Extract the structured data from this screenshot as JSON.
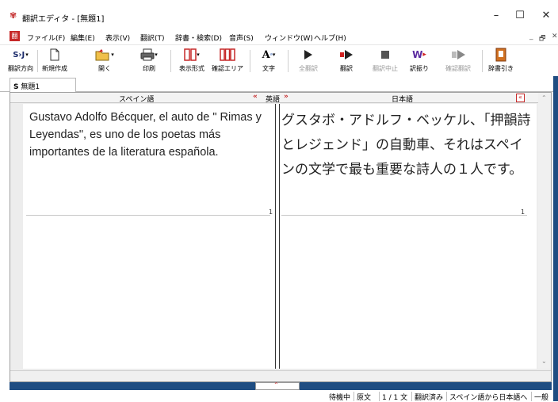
{
  "window": {
    "title": "翻訳エディタ - [無題1]",
    "minimize": "–",
    "maximize": "☐",
    "close": "✕"
  },
  "menu": [
    "ファイル(F)",
    "編集(E)",
    "表示(V)",
    "翻訳(T)",
    "辞書・検索(D)",
    "音声(S)",
    "ウィンドウ(W)",
    "ヘルプ(H)"
  ],
  "mdi_controls": [
    "_",
    "🗗",
    "✕"
  ],
  "toolbar": {
    "direction_icon": "S›J",
    "direction": "翻訳方向",
    "new": "新規作成",
    "open": "開く",
    "print": "印刷",
    "display": "表示形式",
    "confirm_area": "確認エリア",
    "font": "文字",
    "translate_all": "全翻訳",
    "translate": "翻訳",
    "stop": "翻訳中止",
    "reorder": "訳振り",
    "confirm_translate": "確認翻訳",
    "dictionary": "辞書引き"
  },
  "document": {
    "tab_label": "無題1",
    "tab_prefix": "S",
    "source_header": "スペイン語",
    "swap_left": "«",
    "swap_right": "»",
    "middle_header": "英語",
    "target_header": "日本語",
    "collapse": "«",
    "source_text": "Gustavo Adolfo Bécquer, el auto de \" Rimas y Leyendas\", es uno de los poetas más importantes de la literatura española.",
    "target_text": "グスタボ・アドルフ・ベッケル、「押韻詩とレジェンド」の自動車、それはスペインの文学で最も重要な詩人の１人です。",
    "source_sentence_num": "1",
    "target_sentence_num": "1",
    "bottom_toggle": "⌃"
  },
  "status": [
    "待機中",
    "原文",
    "1 / 1 文",
    "翻訳済み",
    "スペイン語から日本語へ",
    "一般"
  ]
}
